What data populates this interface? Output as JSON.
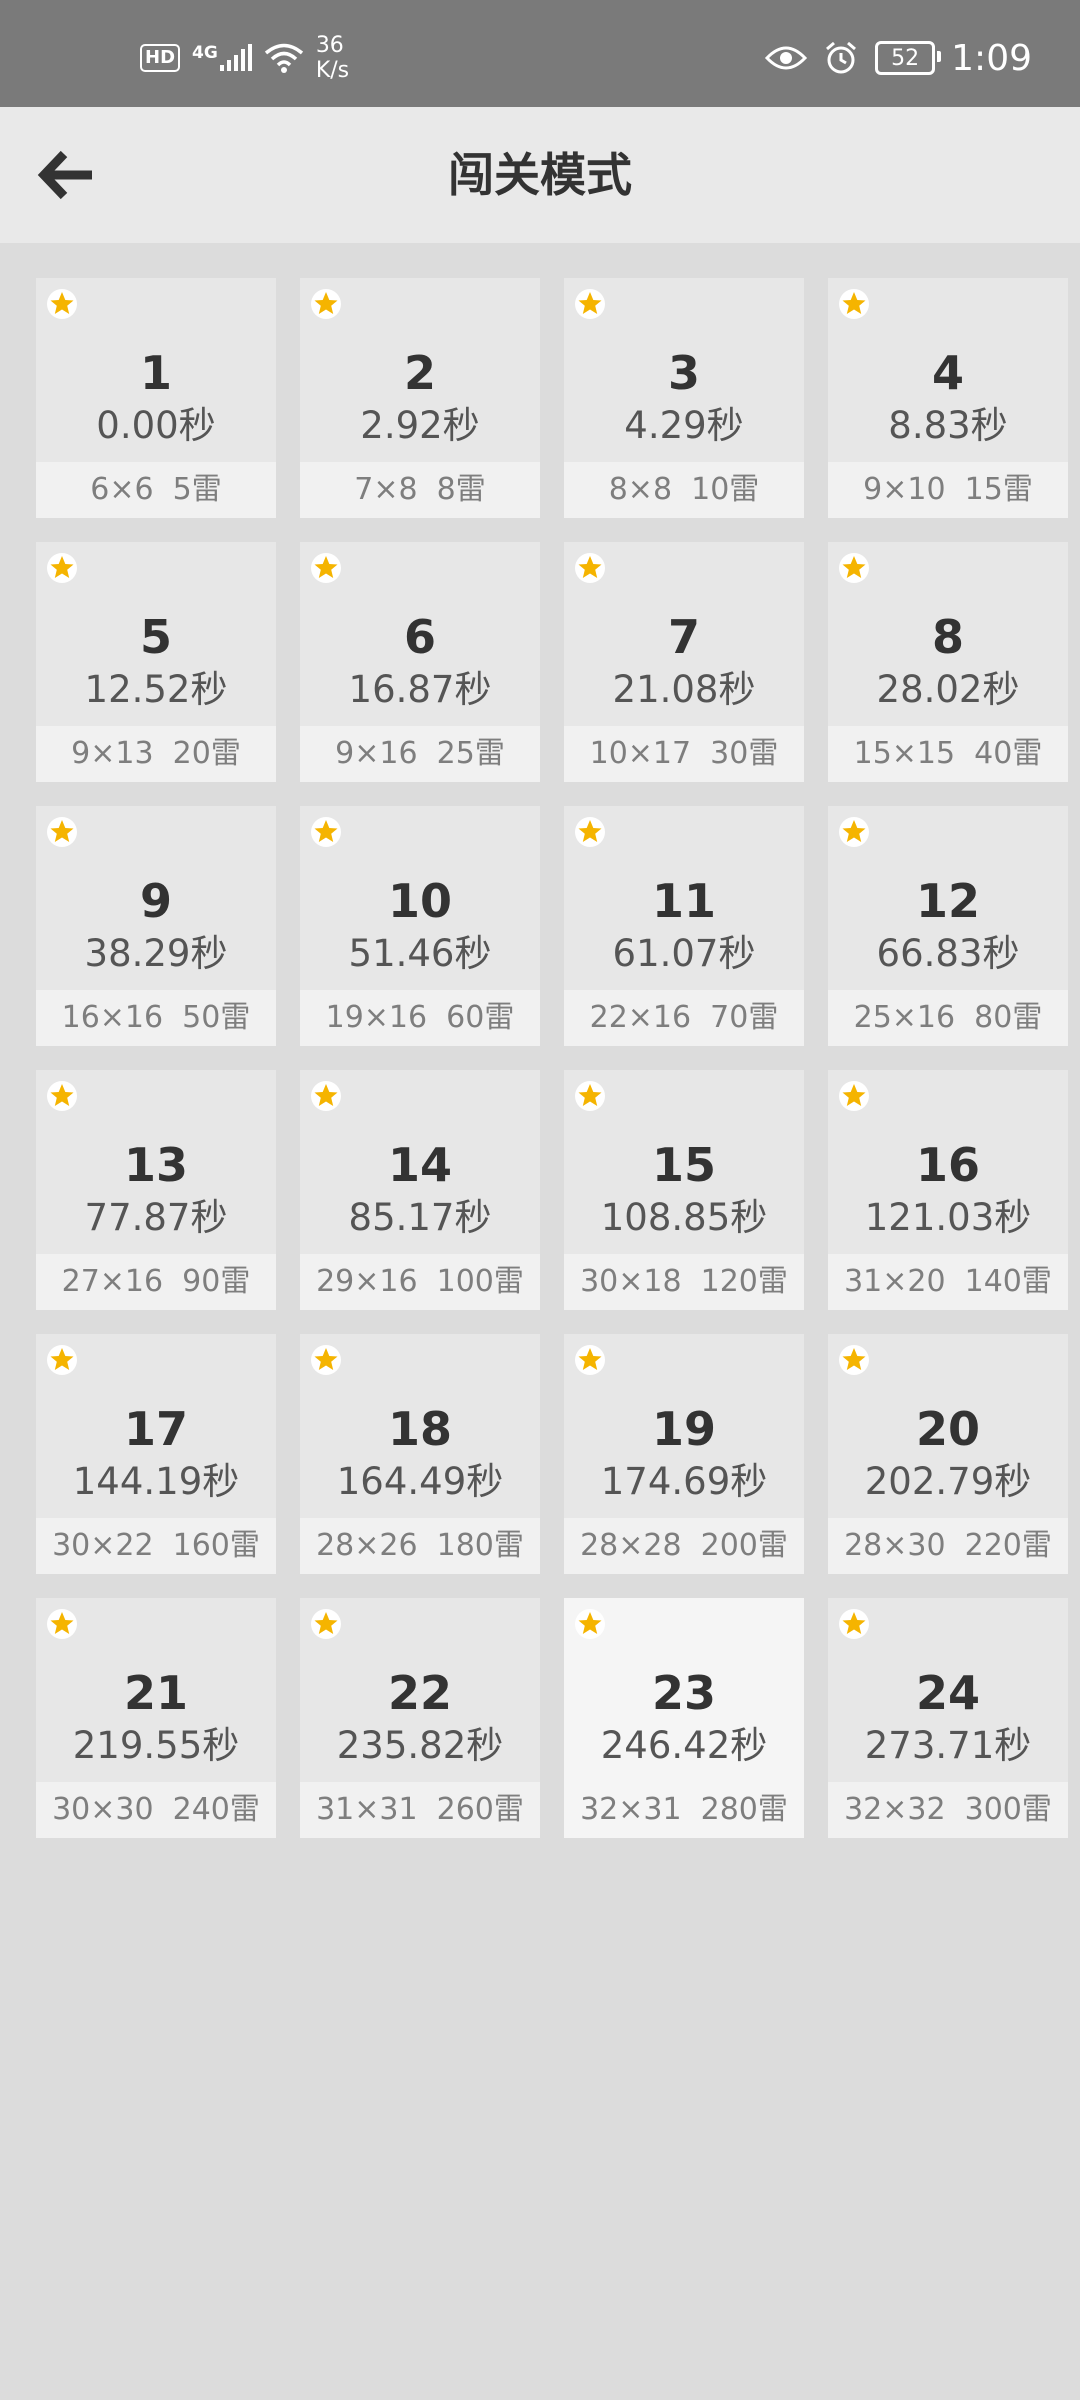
{
  "status_bar": {
    "hd": "HD",
    "network": "4G",
    "speed_value": "36",
    "speed_unit": "K/s",
    "battery": "52",
    "time": "1:09"
  },
  "header": {
    "back_icon": "arrow-left-icon",
    "title": "闯关模式"
  },
  "colors": {
    "status_bar_bg": "#7a7a7a",
    "header_bg": "#e9e9e9",
    "page_bg": "#dcdcdc",
    "card_bg": "#e7e7e7",
    "star": "#f5b400"
  },
  "levels": [
    {
      "num": "1",
      "time": "0.00秒",
      "info": "6×6  5雷",
      "starred": true
    },
    {
      "num": "2",
      "time": "2.92秒",
      "info": "7×8  8雷",
      "starred": true
    },
    {
      "num": "3",
      "time": "4.29秒",
      "info": "8×8  10雷",
      "starred": true
    },
    {
      "num": "4",
      "time": "8.83秒",
      "info": "9×10  15雷",
      "starred": true
    },
    {
      "num": "5",
      "time": "12.52秒",
      "info": "9×13  20雷",
      "starred": true
    },
    {
      "num": "6",
      "time": "16.87秒",
      "info": "9×16  25雷",
      "starred": true
    },
    {
      "num": "7",
      "time": "21.08秒",
      "info": "10×17  30雷",
      "starred": true
    },
    {
      "num": "8",
      "time": "28.02秒",
      "info": "15×15  40雷",
      "starred": true
    },
    {
      "num": "9",
      "time": "38.29秒",
      "info": "16×16  50雷",
      "starred": true
    },
    {
      "num": "10",
      "time": "51.46秒",
      "info": "19×16  60雷",
      "starred": true
    },
    {
      "num": "11",
      "time": "61.07秒",
      "info": "22×16  70雷",
      "starred": true
    },
    {
      "num": "12",
      "time": "66.83秒",
      "info": "25×16  80雷",
      "starred": true
    },
    {
      "num": "13",
      "time": "77.87秒",
      "info": "27×16  90雷",
      "starred": true
    },
    {
      "num": "14",
      "time": "85.17秒",
      "info": "29×16  100雷",
      "starred": true
    },
    {
      "num": "15",
      "time": "108.85秒",
      "info": "30×18  120雷",
      "starred": true
    },
    {
      "num": "16",
      "time": "121.03秒",
      "info": "31×20  140雷",
      "starred": true
    },
    {
      "num": "17",
      "time": "144.19秒",
      "info": "30×22  160雷",
      "starred": true
    },
    {
      "num": "18",
      "time": "164.49秒",
      "info": "28×26  180雷",
      "starred": true
    },
    {
      "num": "19",
      "time": "174.69秒",
      "info": "28×28  200雷",
      "starred": true
    },
    {
      "num": "20",
      "time": "202.79秒",
      "info": "28×30  220雷",
      "starred": true
    },
    {
      "num": "21",
      "time": "219.55秒",
      "info": "30×30  240雷",
      "starred": true
    },
    {
      "num": "22",
      "time": "235.82秒",
      "info": "31×31  260雷",
      "starred": true
    },
    {
      "num": "23",
      "time": "246.42秒",
      "info": "32×31  280雷",
      "starred": true,
      "highlighted": true
    },
    {
      "num": "24",
      "time": "273.71秒",
      "info": "32×32  300雷",
      "starred": true
    }
  ]
}
